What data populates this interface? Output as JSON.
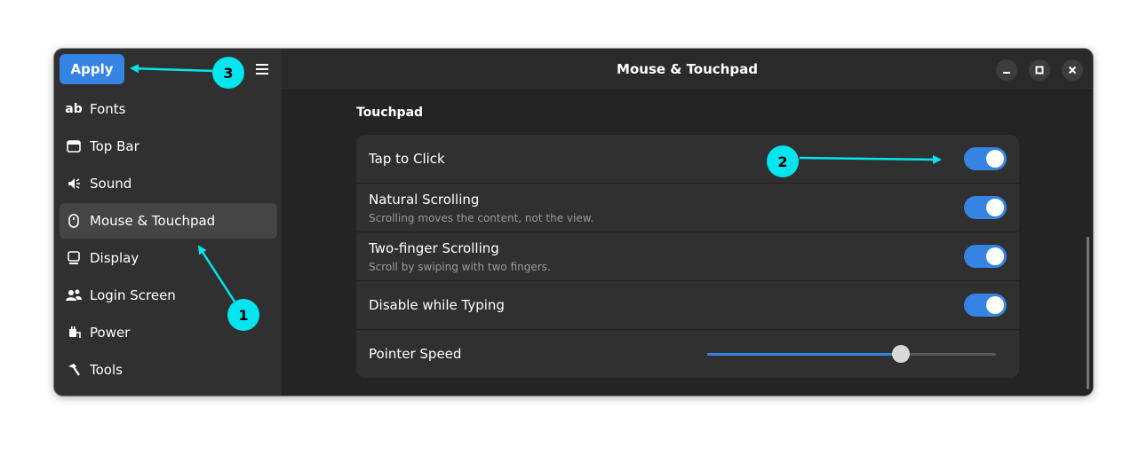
{
  "header": {
    "apply_label": "Apply",
    "menu_icon": "hamburger-menu-icon"
  },
  "window": {
    "title": "Mouse & Touchpad",
    "controls": [
      "minimize-icon",
      "maximize-icon",
      "close-icon"
    ]
  },
  "sidebar": {
    "items": [
      {
        "label": "Fonts",
        "icon": "fonts-icon",
        "active": false
      },
      {
        "label": "Top Bar",
        "icon": "top-bar-icon",
        "active": false
      },
      {
        "label": "Sound",
        "icon": "sound-icon",
        "active": false
      },
      {
        "label": "Mouse & Touchpad",
        "icon": "mouse-icon",
        "active": true
      },
      {
        "label": "Display",
        "icon": "display-icon",
        "active": false
      },
      {
        "label": "Login Screen",
        "icon": "users-icon",
        "active": false
      },
      {
        "label": "Power",
        "icon": "power-plug-icon",
        "active": false
      },
      {
        "label": "Tools",
        "icon": "hammer-icon",
        "active": false
      }
    ]
  },
  "touchpad": {
    "section_title": "Touchpad",
    "rows": [
      {
        "label": "Tap to Click",
        "subtitle": "",
        "toggle": true
      },
      {
        "label": "Natural Scrolling",
        "subtitle": "Scrolling moves the content, not the view.",
        "toggle": true
      },
      {
        "label": "Two-finger Scrolling",
        "subtitle": "Scroll by swiping with two fingers.",
        "toggle": true
      },
      {
        "label": "Disable while Typing",
        "subtitle": "",
        "toggle": true
      }
    ],
    "pointer_speed": {
      "label": "Pointer Speed",
      "value": 0.67
    }
  },
  "annotations": [
    {
      "number": "1",
      "target": "sidebar-item-mouse-touchpad"
    },
    {
      "number": "2",
      "target": "tap-to-click-switch"
    },
    {
      "number": "3",
      "target": "apply-button"
    }
  ],
  "colors": {
    "accent": "#3584e4",
    "annotation": "#00e5ee",
    "window_bg": "#242424",
    "sidebar_bg": "#303030"
  }
}
